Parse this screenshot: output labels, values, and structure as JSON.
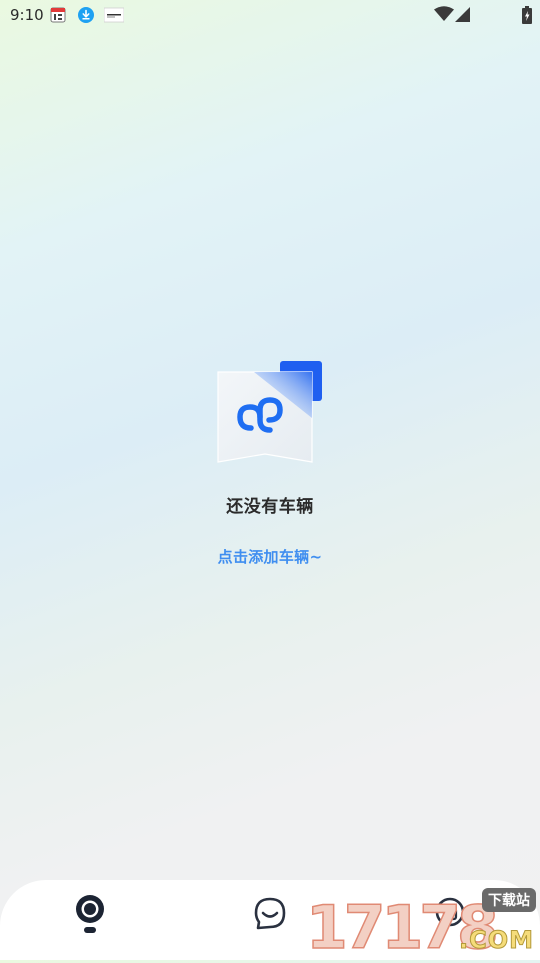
{
  "status_bar": {
    "time": "9:10",
    "notifications": [
      "calendar-notification-icon",
      "download-notification-icon",
      "app-notification-icon"
    ],
    "system": [
      "wifi-icon",
      "cellular-signal-icon",
      "battery-charging-icon"
    ]
  },
  "empty_state": {
    "title": "还没有车辆",
    "action": "点击添加车辆~",
    "icon": "mini-program-icon"
  },
  "bottom_nav": {
    "tabs": [
      {
        "id": "home",
        "icon": "camera-home-icon",
        "active": true
      },
      {
        "id": "chat",
        "icon": "smile-chat-icon",
        "active": false
      },
      {
        "id": "profile",
        "icon": "profile-icon",
        "active": false
      }
    ]
  },
  "watermark": {
    "digits": "17178",
    "badge": "下载站",
    "domain": ".COM"
  },
  "colors": {
    "accent": "#3f8ef0",
    "brand_blue": "#2f66f0",
    "nav_active": "#1c2433"
  }
}
